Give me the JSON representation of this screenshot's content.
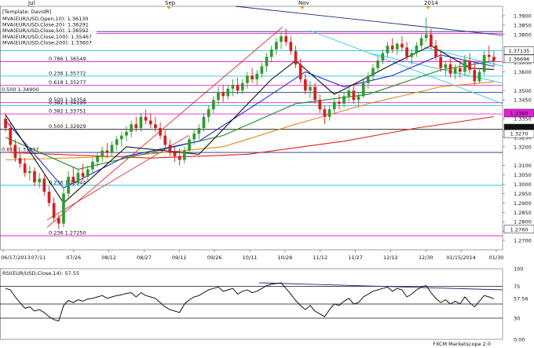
{
  "colors": {
    "bull_candle": "#2f9b2f",
    "bear_candle": "#d42020",
    "fib_magenta": "#e020d8",
    "fib_cyan": "#20c8e0",
    "fib_navy": "#1a2a7a",
    "sma10": "#111111",
    "sma20": "#2a2ae0",
    "sma50": "#1a8a1a",
    "sma100": "#e08a1a",
    "sma200": "#e02020",
    "rsi_line": "#111111",
    "trend_red": "#e03030",
    "trend_navy": "#1a2a7a",
    "channel_cyan": "#30c8e8"
  },
  "chart_data": {
    "type": "candlestick",
    "symbol": "EUR/USD",
    "top_months": [
      "Jul",
      "Sep",
      "Nov",
      "2014"
    ],
    "x_ticks": [
      "06/17/2013",
      "07/11",
      "07/26",
      "08/12",
      "08/27",
      "09/11",
      "09/26",
      "10/11",
      "10/28",
      "11/12",
      "11/27",
      "12/12",
      "12/30",
      "01/15/2014",
      "01/30"
    ],
    "ylim": [
      1.265,
      1.395
    ],
    "y_ticks": [
      {
        "label": "1.3900",
        "value": 1.39
      },
      {
        "label": "1.3850",
        "value": 1.385
      },
      {
        "label": "1.3800",
        "value": 1.38
      },
      {
        "label": "1.3650",
        "value": 1.365
      },
      {
        "label": "1.3600",
        "value": 1.36
      },
      {
        "label": "1.3500",
        "value": 1.35
      },
      {
        "label": "1.3450",
        "value": 1.345
      },
      {
        "label": "1.3350",
        "value": 1.335
      },
      {
        "label": "1.3250",
        "value": 1.325
      },
      {
        "label": "1.3200",
        "value": 1.32
      },
      {
        "label": "1.3100",
        "value": 1.31
      },
      {
        "label": "1.3050",
        "value": 1.305
      },
      {
        "label": "1.3000",
        "value": 1.3
      },
      {
        "label": "1.2950",
        "value": 1.295
      },
      {
        "label": "1.2900",
        "value": 1.29
      },
      {
        "label": "1.2850",
        "value": 1.285
      },
      {
        "label": "1.2800",
        "value": 1.28
      },
      {
        "label": "1.2750",
        "value": 1.275
      },
      {
        "label": "1.2700",
        "value": 1.27
      }
    ],
    "price_boxes": [
      {
        "label": "1.37135",
        "value": 1.37135,
        "color": "#ffffff"
      },
      {
        "label": "1.36696",
        "value": 1.36696,
        "color": "#ffffff"
      },
      {
        "label": "1.3380",
        "value": 1.338,
        "color": "#e020d8"
      },
      {
        "label": "1.3300",
        "value": 1.33,
        "color": "#111111"
      },
      {
        "label": "1.3270",
        "value": 1.327,
        "color": "#ffffff"
      },
      {
        "label": "1.2760",
        "value": 1.276,
        "color": "#ffffff"
      }
    ],
    "legend_title": "[Template: DavidR]",
    "legend": [
      {
        "label": "MVA(EUR/USD,Open,10): 1.36130",
        "color": "#111111"
      },
      {
        "label": "MVA(EUR/USD,Close,20): 1.36291",
        "color": "#2a2ae0"
      },
      {
        "label": "MVA(EUR/USD,Close,50): 1.36592",
        "color": "#1a8a1a"
      },
      {
        "label": "MVA(EUR/USD,Close,100): 1.35467",
        "color": "#e08a1a"
      },
      {
        "label": "MVA(EUR/USD,Close,200): 1.33607",
        "color": "#e02020"
      }
    ],
    "levels": [
      {
        "label": "",
        "value": 1.3815,
        "color": "#1a2a7a"
      },
      {
        "label": "",
        "value": 1.3805,
        "color": "#e020d8"
      },
      {
        "label": "",
        "value": 1.3713,
        "color": "#20c8e0"
      },
      {
        "label": "0.786 1.36549",
        "value": 1.36549,
        "color": "#e020d8"
      },
      {
        "label": "0.236 1.35772",
        "value": 1.35772,
        "color": "#20c8e0"
      },
      {
        "label": "0.618 1.35277",
        "value": 1.35277,
        "color": "#e020d8"
      },
      {
        "label": "0.500 1.34900",
        "value": 1.349,
        "color": "#1a2a7a"
      },
      {
        "label": "0.500 1.34354",
        "value": 1.34354,
        "color": "#e020d8"
      },
      {
        "label": "0.382 1.34199",
        "value": 1.34199,
        "color": "#20c8e0"
      },
      {
        "label": "0.382 1.33751",
        "value": 1.33751,
        "color": "#e020d8"
      },
      {
        "label": "0.500 1.32929",
        "value": 1.32929,
        "color": "#111111"
      },
      {
        "label": "0.618 1.31697",
        "value": 1.31697,
        "color": "#1a2a7a"
      },
      {
        "label": "0.236 1.29944",
        "value": 1.29944,
        "color": "#20c8e0"
      },
      {
        "label": "0.236 1.27250",
        "value": 1.2725,
        "color": "#e020d8"
      }
    ],
    "ohlc": [
      [
        1.335,
        1.338,
        1.328,
        1.33
      ],
      [
        1.33,
        1.333,
        1.318,
        1.321
      ],
      [
        1.321,
        1.324,
        1.312,
        1.314
      ],
      [
        1.314,
        1.317,
        1.309,
        1.311
      ],
      [
        1.311,
        1.314,
        1.304,
        1.306
      ],
      [
        1.306,
        1.31,
        1.302,
        1.307
      ],
      [
        1.307,
        1.309,
        1.299,
        1.301
      ],
      [
        1.301,
        1.306,
        1.298,
        1.303
      ],
      [
        1.303,
        1.305,
        1.294,
        1.296
      ],
      [
        1.296,
        1.299,
        1.288,
        1.29
      ],
      [
        1.29,
        1.293,
        1.28,
        1.282
      ],
      [
        1.282,
        1.284,
        1.276,
        1.279
      ],
      [
        1.279,
        1.298,
        1.277,
        1.295
      ],
      [
        1.295,
        1.307,
        1.293,
        1.304
      ],
      [
        1.304,
        1.309,
        1.299,
        1.301
      ],
      [
        1.301,
        1.308,
        1.299,
        1.306
      ],
      [
        1.306,
        1.311,
        1.302,
        1.304
      ],
      [
        1.304,
        1.31,
        1.302,
        1.308
      ],
      [
        1.308,
        1.314,
        1.306,
        1.312
      ],
      [
        1.312,
        1.317,
        1.309,
        1.315
      ],
      [
        1.315,
        1.32,
        1.312,
        1.318
      ],
      [
        1.318,
        1.322,
        1.314,
        1.317
      ],
      [
        1.317,
        1.323,
        1.315,
        1.321
      ],
      [
        1.321,
        1.326,
        1.318,
        1.324
      ],
      [
        1.324,
        1.328,
        1.32,
        1.326
      ],
      [
        1.326,
        1.331,
        1.323,
        1.328
      ],
      [
        1.328,
        1.334,
        1.325,
        1.332
      ],
      [
        1.332,
        1.336,
        1.328,
        1.33
      ],
      [
        1.33,
        1.338,
        1.328,
        1.336
      ],
      [
        1.336,
        1.34,
        1.332,
        1.334
      ],
      [
        1.334,
        1.338,
        1.33,
        1.332
      ],
      [
        1.332,
        1.336,
        1.328,
        1.33
      ],
      [
        1.33,
        1.333,
        1.324,
        1.326
      ],
      [
        1.326,
        1.329,
        1.319,
        1.321
      ],
      [
        1.321,
        1.324,
        1.315,
        1.317
      ],
      [
        1.317,
        1.32,
        1.312,
        1.315
      ],
      [
        1.315,
        1.319,
        1.31,
        1.313
      ],
      [
        1.313,
        1.32,
        1.311,
        1.318
      ],
      [
        1.318,
        1.326,
        1.316,
        1.324
      ],
      [
        1.324,
        1.329,
        1.321,
        1.327
      ],
      [
        1.327,
        1.332,
        1.324,
        1.33
      ],
      [
        1.33,
        1.338,
        1.328,
        1.336
      ],
      [
        1.336,
        1.342,
        1.333,
        1.34
      ],
      [
        1.34,
        1.347,
        1.338,
        1.345
      ],
      [
        1.345,
        1.352,
        1.342,
        1.349
      ],
      [
        1.349,
        1.353,
        1.344,
        1.347
      ],
      [
        1.347,
        1.353,
        1.345,
        1.351
      ],
      [
        1.351,
        1.356,
        1.347,
        1.353
      ],
      [
        1.353,
        1.357,
        1.348,
        1.35
      ],
      [
        1.35,
        1.356,
        1.348,
        1.354
      ],
      [
        1.354,
        1.36,
        1.351,
        1.358
      ],
      [
        1.358,
        1.362,
        1.354,
        1.356
      ],
      [
        1.356,
        1.361,
        1.353,
        1.359
      ],
      [
        1.359,
        1.365,
        1.357,
        1.363
      ],
      [
        1.363,
        1.37,
        1.36,
        1.368
      ],
      [
        1.368,
        1.374,
        1.365,
        1.372
      ],
      [
        1.372,
        1.378,
        1.369,
        1.376
      ],
      [
        1.376,
        1.381,
        1.372,
        1.379
      ],
      [
        1.379,
        1.383,
        1.374,
        1.376
      ],
      [
        1.376,
        1.379,
        1.369,
        1.371
      ],
      [
        1.371,
        1.374,
        1.362,
        1.364
      ],
      [
        1.364,
        1.367,
        1.354,
        1.356
      ],
      [
        1.356,
        1.359,
        1.348,
        1.35
      ],
      [
        1.35,
        1.355,
        1.346,
        1.352
      ],
      [
        1.352,
        1.354,
        1.343,
        1.345
      ],
      [
        1.345,
        1.348,
        1.338,
        1.34
      ],
      [
        1.34,
        1.342,
        1.332,
        1.336
      ],
      [
        1.336,
        1.342,
        1.334,
        1.34
      ],
      [
        1.34,
        1.346,
        1.338,
        1.344
      ],
      [
        1.344,
        1.348,
        1.34,
        1.343
      ],
      [
        1.343,
        1.349,
        1.341,
        1.347
      ],
      [
        1.347,
        1.352,
        1.344,
        1.35
      ],
      [
        1.35,
        1.353,
        1.343,
        1.345
      ],
      [
        1.345,
        1.349,
        1.342,
        1.347
      ],
      [
        1.347,
        1.356,
        1.346,
        1.354
      ],
      [
        1.354,
        1.36,
        1.351,
        1.358
      ],
      [
        1.358,
        1.364,
        1.355,
        1.362
      ],
      [
        1.362,
        1.368,
        1.36,
        1.366
      ],
      [
        1.366,
        1.372,
        1.364,
        1.37
      ],
      [
        1.37,
        1.376,
        1.368,
        1.374
      ],
      [
        1.374,
        1.378,
        1.37,
        1.372
      ],
      [
        1.372,
        1.376,
        1.369,
        1.375
      ],
      [
        1.375,
        1.379,
        1.371,
        1.373
      ],
      [
        1.373,
        1.376,
        1.366,
        1.368
      ],
      [
        1.368,
        1.372,
        1.364,
        1.37
      ],
      [
        1.37,
        1.376,
        1.368,
        1.374
      ],
      [
        1.374,
        1.38,
        1.372,
        1.378
      ],
      [
        1.378,
        1.389,
        1.376,
        1.38
      ],
      [
        1.38,
        1.383,
        1.372,
        1.374
      ],
      [
        1.374,
        1.377,
        1.366,
        1.368
      ],
      [
        1.368,
        1.372,
        1.36,
        1.362
      ],
      [
        1.362,
        1.366,
        1.358,
        1.364
      ],
      [
        1.364,
        1.368,
        1.357,
        1.359
      ],
      [
        1.359,
        1.364,
        1.356,
        1.362
      ],
      [
        1.362,
        1.366,
        1.357,
        1.36
      ],
      [
        1.36,
        1.369,
        1.358,
        1.366
      ],
      [
        1.366,
        1.37,
        1.359,
        1.361
      ],
      [
        1.361,
        1.365,
        1.353,
        1.355
      ],
      [
        1.355,
        1.362,
        1.354,
        1.36
      ],
      [
        1.36,
        1.371,
        1.358,
        1.369
      ],
      [
        1.369,
        1.374,
        1.365,
        1.368
      ],
      [
        1.368,
        1.371,
        1.363,
        1.366
      ]
    ],
    "sma10": [
      [
        0,
        1.337
      ],
      [
        12,
        1.29
      ],
      [
        25,
        1.32
      ],
      [
        40,
        1.316
      ],
      [
        55,
        1.356
      ],
      [
        60,
        1.366
      ],
      [
        68,
        1.348
      ],
      [
        80,
        1.364
      ],
      [
        88,
        1.374
      ],
      [
        96,
        1.362
      ],
      [
        101,
        1.3613
      ]
    ],
    "sma20": [
      [
        0,
        1.334
      ],
      [
        12,
        1.298
      ],
      [
        25,
        1.315
      ],
      [
        40,
        1.323
      ],
      [
        55,
        1.348
      ],
      [
        62,
        1.36
      ],
      [
        70,
        1.352
      ],
      [
        80,
        1.358
      ],
      [
        90,
        1.369
      ],
      [
        101,
        1.3629
      ]
    ],
    "sma50": [
      [
        0,
        1.325
      ],
      [
        15,
        1.308
      ],
      [
        30,
        1.317
      ],
      [
        45,
        1.326
      ],
      [
        60,
        1.343
      ],
      [
        75,
        1.348
      ],
      [
        90,
        1.361
      ],
      [
        101,
        1.3659
      ]
    ],
    "sma100": [
      [
        0,
        1.313
      ],
      [
        25,
        1.315
      ],
      [
        45,
        1.32
      ],
      [
        60,
        1.332
      ],
      [
        75,
        1.343
      ],
      [
        90,
        1.352
      ],
      [
        101,
        1.3547
      ]
    ],
    "sma200": [
      [
        0,
        1.317
      ],
      [
        30,
        1.314
      ],
      [
        50,
        1.316
      ],
      [
        70,
        1.323
      ],
      [
        85,
        1.33
      ],
      [
        101,
        1.3361
      ]
    ],
    "rsi": [
      72,
      70,
      60,
      52,
      44,
      46,
      40,
      42,
      38,
      32,
      28,
      26,
      48,
      55,
      52,
      56,
      54,
      57,
      58,
      60,
      62,
      58,
      60,
      62,
      63,
      65,
      66,
      60,
      66,
      62,
      60,
      58,
      52,
      46,
      42,
      40,
      38,
      50,
      56,
      60,
      62,
      66,
      70,
      72,
      74,
      68,
      70,
      72,
      64,
      68,
      70,
      66,
      68,
      72,
      76,
      78,
      79,
      80,
      72,
      64,
      55,
      48,
      42,
      48,
      40,
      36,
      32,
      42,
      50,
      48,
      54,
      58,
      50,
      52,
      60,
      64,
      68,
      70,
      72,
      74,
      68,
      72,
      70,
      60,
      64,
      70,
      74,
      76,
      66,
      58,
      52,
      56,
      50,
      54,
      50,
      60,
      52,
      46,
      54,
      62,
      60,
      57.5
    ],
    "rsi_label": "RSI(EUR/USD,Close,14): 57.55",
    "rsi_ylim": [
      0,
      100
    ],
    "rsi_ticks": [
      {
        "label": "100",
        "value": 100
      },
      {
        "label": "75",
        "value": 75
      },
      {
        "label": "57.56",
        "value": 57.56
      },
      {
        "label": "30",
        "value": 30
      },
      {
        "label": "0.00",
        "value": 0
      }
    ],
    "footer": "FXCM Marketscope 2.0"
  }
}
